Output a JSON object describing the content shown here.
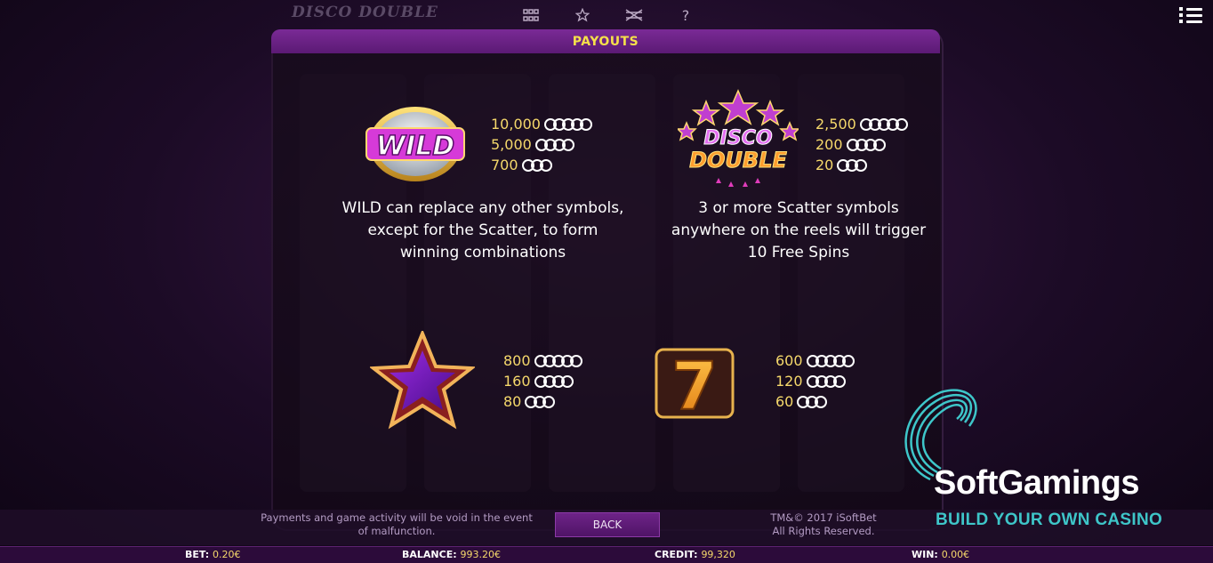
{
  "game": {
    "title": "DISCO DOUBLE"
  },
  "header": {
    "title": "PAYOUTS"
  },
  "topbar": {
    "icons": [
      "grid-icon",
      "star-icon",
      "lines-icon",
      "help-icon"
    ],
    "help_glyph": "?"
  },
  "payouts": {
    "wild": {
      "label": "WILD",
      "rows": [
        {
          "amount": "10,000",
          "count": 5
        },
        {
          "amount": "5,000",
          "count": 4
        },
        {
          "amount": "700",
          "count": 3
        }
      ],
      "description_lines": [
        "WILD can replace any other symbols,",
        "except for the Scatter, to form",
        "winning combinations"
      ]
    },
    "scatter": {
      "label_top": "DISCO",
      "label_bottom": "DOUBLE",
      "rows": [
        {
          "amount": "2,500",
          "count": 5
        },
        {
          "amount": "200",
          "count": 4
        },
        {
          "amount": "20",
          "count": 3
        }
      ],
      "description_lines": [
        "3 or more Scatter symbols",
        "anywhere on the reels will trigger",
        "10 Free Spins"
      ]
    },
    "star": {
      "rows": [
        {
          "amount": "800",
          "count": 5
        },
        {
          "amount": "160",
          "count": 4
        },
        {
          "amount": "80",
          "count": 3
        }
      ]
    },
    "seven": {
      "glyph": "7",
      "rows": [
        {
          "amount": "600",
          "count": 5
        },
        {
          "amount": "120",
          "count": 4
        },
        {
          "amount": "60",
          "count": 3
        }
      ]
    }
  },
  "footer": {
    "disclaimer": "Payments and game activity will be void in the event of malfunction.",
    "back_label": "BACK",
    "copyright_line1": "TM&© 2017 iSoftBet",
    "copyright_line2": "All Rights Reserved."
  },
  "status": {
    "bet_label": "BET:",
    "bet_value": "0.20€",
    "balance_label": "BALANCE:",
    "balance_value": "993.20€",
    "credit_label": "CREDIT:",
    "credit_value": "99,320",
    "win_label": "WIN:",
    "win_value": "0.00€"
  },
  "watermark": {
    "name": "SoftGamings",
    "tagline": "BUILD YOUR OWN CASINO"
  },
  "colors": {
    "accent_purple": "#6e2388",
    "payout_gold": "#f5d86b",
    "header_gold": "#f5e04a",
    "brand_teal": "#3ec6c9"
  }
}
